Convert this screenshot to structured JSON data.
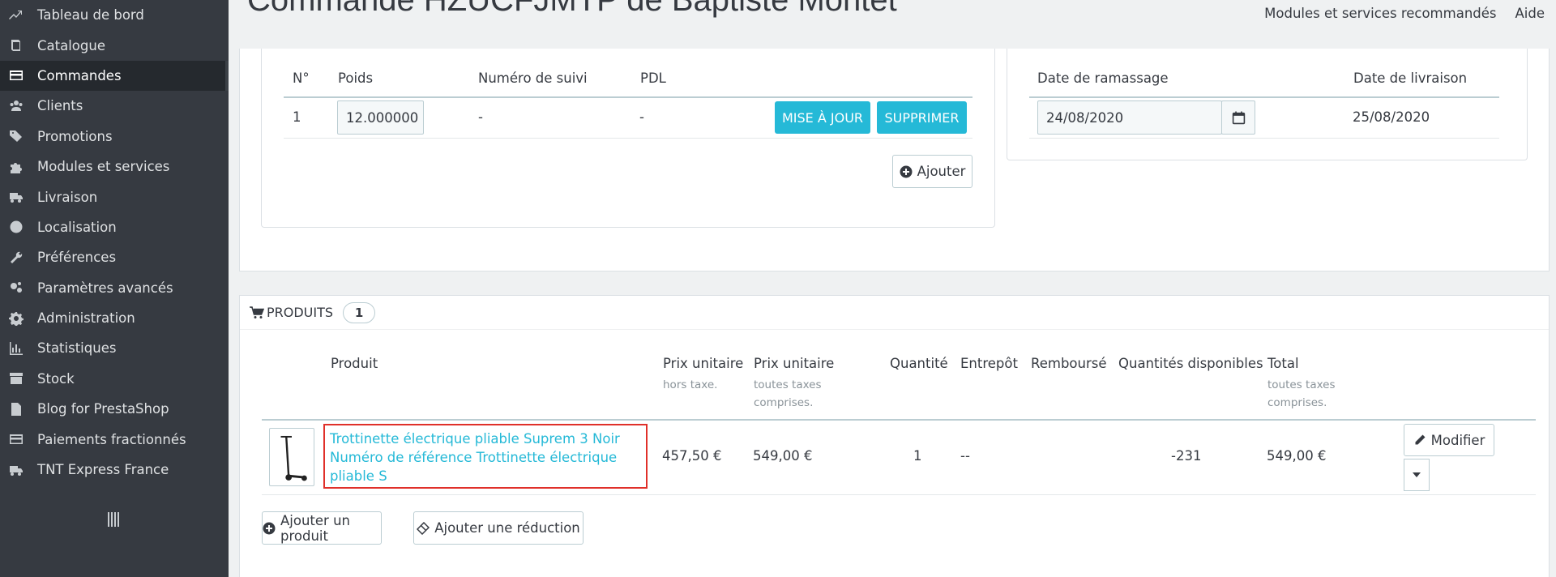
{
  "sidebar": {
    "items": [
      {
        "label": "Tableau de bord",
        "icon": "trend-icon"
      },
      {
        "label": "Catalogue",
        "icon": "book-icon"
      },
      {
        "label": "Commandes",
        "icon": "card-icon",
        "active": true
      },
      {
        "label": "Clients",
        "icon": "users-icon"
      },
      {
        "label": "Promotions",
        "icon": "tags-icon"
      },
      {
        "label": "Modules et services",
        "icon": "puzzle-icon"
      },
      {
        "label": "Livraison",
        "icon": "truck-icon"
      },
      {
        "label": "Localisation",
        "icon": "globe-icon"
      },
      {
        "label": "Préférences",
        "icon": "wrench-icon"
      },
      {
        "label": "Paramètres avancés",
        "icon": "cogs-icon"
      },
      {
        "label": "Administration",
        "icon": "gear-icon"
      },
      {
        "label": "Statistiques",
        "icon": "bar-chart-icon"
      },
      {
        "label": "Stock",
        "icon": "archive-icon"
      },
      {
        "label": "Blog for PrestaShop",
        "icon": "document-icon"
      },
      {
        "label": "Paiements fractionnés",
        "icon": "card-icon"
      },
      {
        "label": "TNT Express France",
        "icon": "truck-icon"
      }
    ]
  },
  "header": {
    "title": "Commande HZUCFJMTP de Baptiste Montet",
    "links": [
      "Modules et services recommandés",
      "Aide"
    ]
  },
  "shipping": {
    "headers": {
      "num": "N°",
      "weight": "Poids",
      "tracking": "Numéro de suivi",
      "pdl": "PDL"
    },
    "row": {
      "num": "1",
      "weight": "12.000000",
      "tracking": "-",
      "pdl": "-"
    },
    "update_label": "MISE À JOUR",
    "delete_label": "SUPPRIMER",
    "add_label": "Ajouter"
  },
  "pickup": {
    "headers": {
      "pickup_date": "Date de ramassage",
      "delivery_date": "Date de livraison"
    },
    "pickup_date_value": "24/08/2020",
    "delivery_date_value": "25/08/2020"
  },
  "products": {
    "title": "PRODUITS",
    "count": "1",
    "headers": {
      "product": "Produit",
      "unit_price_ht": "Prix unitaire",
      "unit_price_ht_sub": "hors taxe.",
      "unit_price_ttc": "Prix unitaire",
      "unit_price_ttc_sub": "toutes taxes comprises.",
      "quantity": "Quantité",
      "warehouse": "Entrepôt",
      "refunded": "Remboursé",
      "available": "Quantités disponibles",
      "total": "Total",
      "total_sub": "toutes taxes comprises."
    },
    "row": {
      "name": "Trottinette électrique pliable Suprem 3 Noir",
      "reference": "Numéro de référence Trottinette électrique pliable S",
      "price_ht": "457,50 €",
      "price_ttc": "549,00 €",
      "quantity": "1",
      "warehouse": "--",
      "available": "-231",
      "total": "549,00 €"
    },
    "edit_label": "Modifier",
    "add_product_label": "Ajouter un produit",
    "add_discount_label": "Ajouter une réduction"
  }
}
